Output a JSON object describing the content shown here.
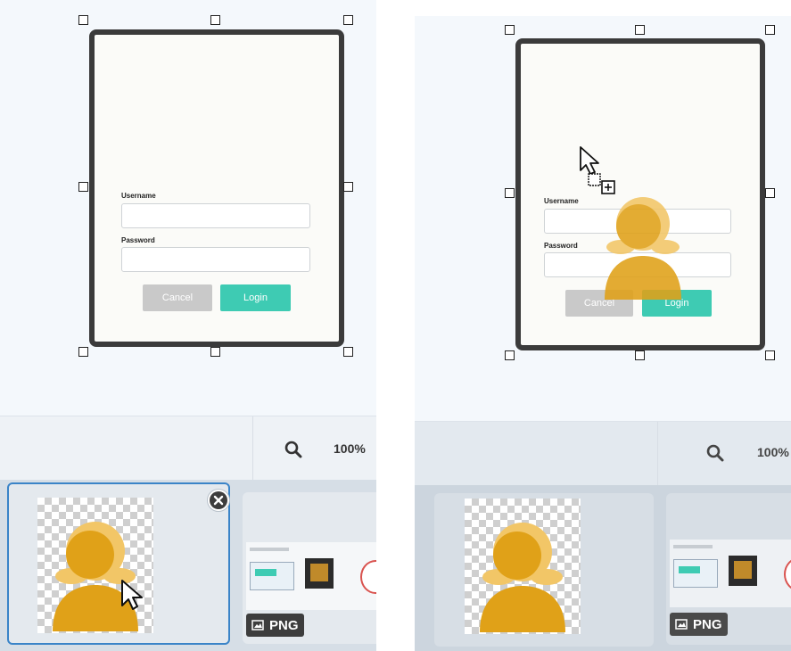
{
  "login_form": {
    "username_label": "Username",
    "password_label": "Password",
    "cancel_label": "Cancel",
    "login_label": "Login"
  },
  "toolbar": {
    "zoom_level": "100%",
    "zoom_icon": "search-icon"
  },
  "tray": {
    "items": [
      {
        "type": "image",
        "icon": "user-avatar",
        "selected": true
      },
      {
        "type": "screenshot",
        "badge": "PNG",
        "badge_icon": "image-icon"
      }
    ]
  },
  "colors": {
    "accent_teal": "#3ecbb3",
    "avatar_gold": "#e0a118",
    "avatar_hair": "#f2c667",
    "selection_blue": "#3a84c8"
  }
}
